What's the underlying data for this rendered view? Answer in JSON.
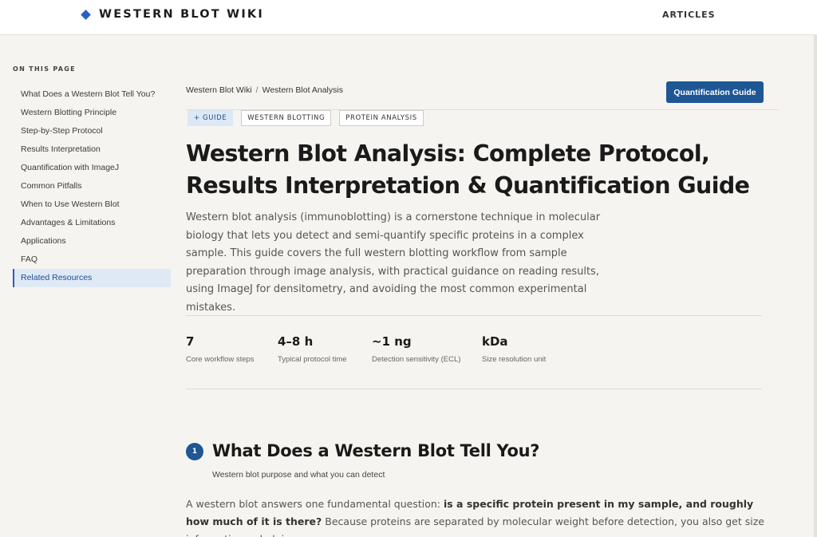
{
  "header": {
    "brand_icon": "diamond-icon",
    "brand_name": "WESTERN BLOT WIKI",
    "nav_articles": "ARTICLES",
    "accent_color": "#2c5dc7"
  },
  "toc": {
    "heading": "ON THIS PAGE",
    "items": [
      {
        "label": "What Does a Western Blot Tell You?",
        "active": false
      },
      {
        "label": "Western Blotting Principle",
        "active": false
      },
      {
        "label": "Step-by-Step Protocol",
        "active": false
      },
      {
        "label": "Results Interpretation",
        "active": false
      },
      {
        "label": "Quantification with ImageJ",
        "active": false
      },
      {
        "label": "Common Pitfalls",
        "active": false
      },
      {
        "label": "When to Use Western Blot",
        "active": false
      },
      {
        "label": "Advantages & Limitations",
        "active": false
      },
      {
        "label": "Applications",
        "active": false
      },
      {
        "label": "FAQ",
        "active": false
      },
      {
        "label": "Related Resources",
        "active": true
      }
    ]
  },
  "breadcrumb": {
    "items": [
      "Western Blot Wiki",
      "Western Blot Analysis"
    ],
    "separator": "/"
  },
  "cta_button": {
    "label": "Quantification Guide",
    "color": "#1f5694"
  },
  "tags": [
    "+ GUIDE",
    "WESTERN BLOTTING",
    "PROTEIN ANALYSIS"
  ],
  "page_title": "Western Blot Analysis: Complete Protocol, Results Interpretation & Quantification Guide",
  "intro": "Western blot analysis (immunoblotting) is a cornerstone technique in molecular biology that lets you detect and semi-quantify specific proteins in a complex sample. This guide covers the full western blotting workflow from sample preparation through image analysis, with practical guidance on reading results, using ImageJ for densitometry, and avoiding the most common experimental mistakes.",
  "stats": [
    {
      "value": "7",
      "label": "Core workflow steps"
    },
    {
      "value": "4–8 h",
      "label": "Typical protocol time"
    },
    {
      "value": "~1 ng",
      "label": "Detection sensitivity (ECL)"
    },
    {
      "value": "kDa",
      "label": "Size resolution unit"
    }
  ],
  "section1": {
    "number": "1",
    "title": "What Does a Western Blot Tell You?",
    "subtitle": "Western blot purpose and what you can detect",
    "para_lead": "A western blot answers one fundamental question: ",
    "para_bold": "is a specific protein present in my sample, and roughly how much of it is there?",
    "para_rest": " Because proteins are separated by molecular weight before detection, you also get size information — helping"
  }
}
